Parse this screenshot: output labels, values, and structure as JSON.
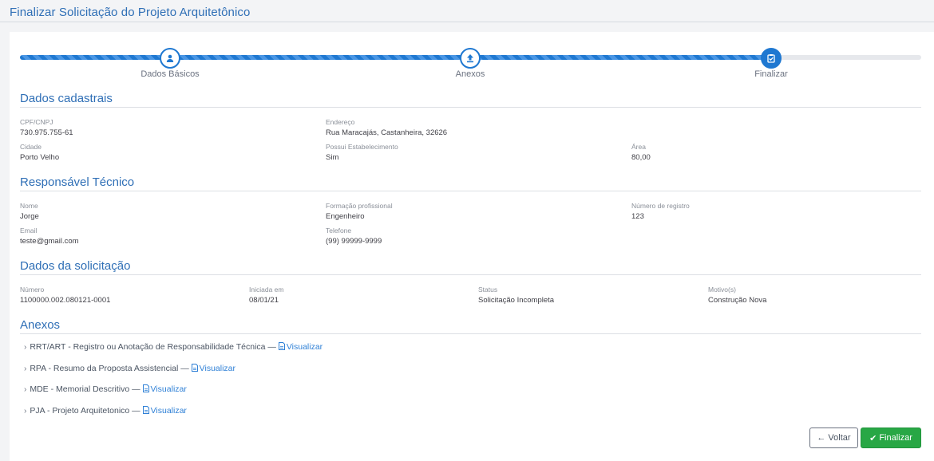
{
  "page": {
    "title": "Finalizar Solicitação do Projeto Arquitetônico"
  },
  "stepper": {
    "steps": [
      {
        "label": "Dados Básicos",
        "icon": "user-icon"
      },
      {
        "label": "Anexos",
        "icon": "upload-icon"
      },
      {
        "label": "Finalizar",
        "icon": "clipboard-check-icon"
      }
    ],
    "current_step": 3,
    "progress_fraction": 0.83
  },
  "dados_cadastrais": {
    "title": "Dados cadastrais",
    "cpf_label": "CPF/CNPJ",
    "cpf": "730.975.755-61",
    "endereco_label": "Endereço",
    "endereco": "Rua Maracajás, Castanheira, 32626",
    "cidade_label": "Cidade",
    "cidade": "Porto Velho",
    "estab_label": "Possui Estabelecimento",
    "estab": "Sim",
    "area_label": "Área",
    "area": "80,00"
  },
  "responsavel": {
    "title": "Responsável Técnico",
    "nome_label": "Nome",
    "nome": "Jorge",
    "formacao_label": "Formação profissional",
    "formacao": "Engenheiro",
    "registro_label": "Número de registro",
    "registro": "123",
    "email_label": "Email",
    "email": "teste@gmail.com",
    "telefone_label": "Telefone",
    "telefone": "(99) 99999-9999"
  },
  "solicitacao": {
    "title": "Dados da solicitação",
    "numero_label": "Número",
    "numero": "1100000.002.080121-0001",
    "iniciada_label": "Iniciada em",
    "iniciada": "08/01/21",
    "status_label": "Status",
    "status": "Solicitação Incompleta",
    "motivo_label": "Motivo(s)",
    "motivo": "Construção Nova"
  },
  "anexos": {
    "title": "Anexos",
    "link_label": "Visualizar",
    "items": [
      {
        "text": "RRT/ART - Registro ou Anotação de Responsabilidade Técnica —"
      },
      {
        "text": "RPA - Resumo da Proposta Assistencial —"
      },
      {
        "text": "MDE - Memorial Descritivo —"
      },
      {
        "text": "PJA - Projeto Arquitetonico —"
      }
    ]
  },
  "actions": {
    "back_label": "Voltar",
    "finish_label": "Finalizar"
  },
  "colors": {
    "accent": "#1f78d1",
    "title": "#2f6fb6",
    "success": "#28a745"
  }
}
